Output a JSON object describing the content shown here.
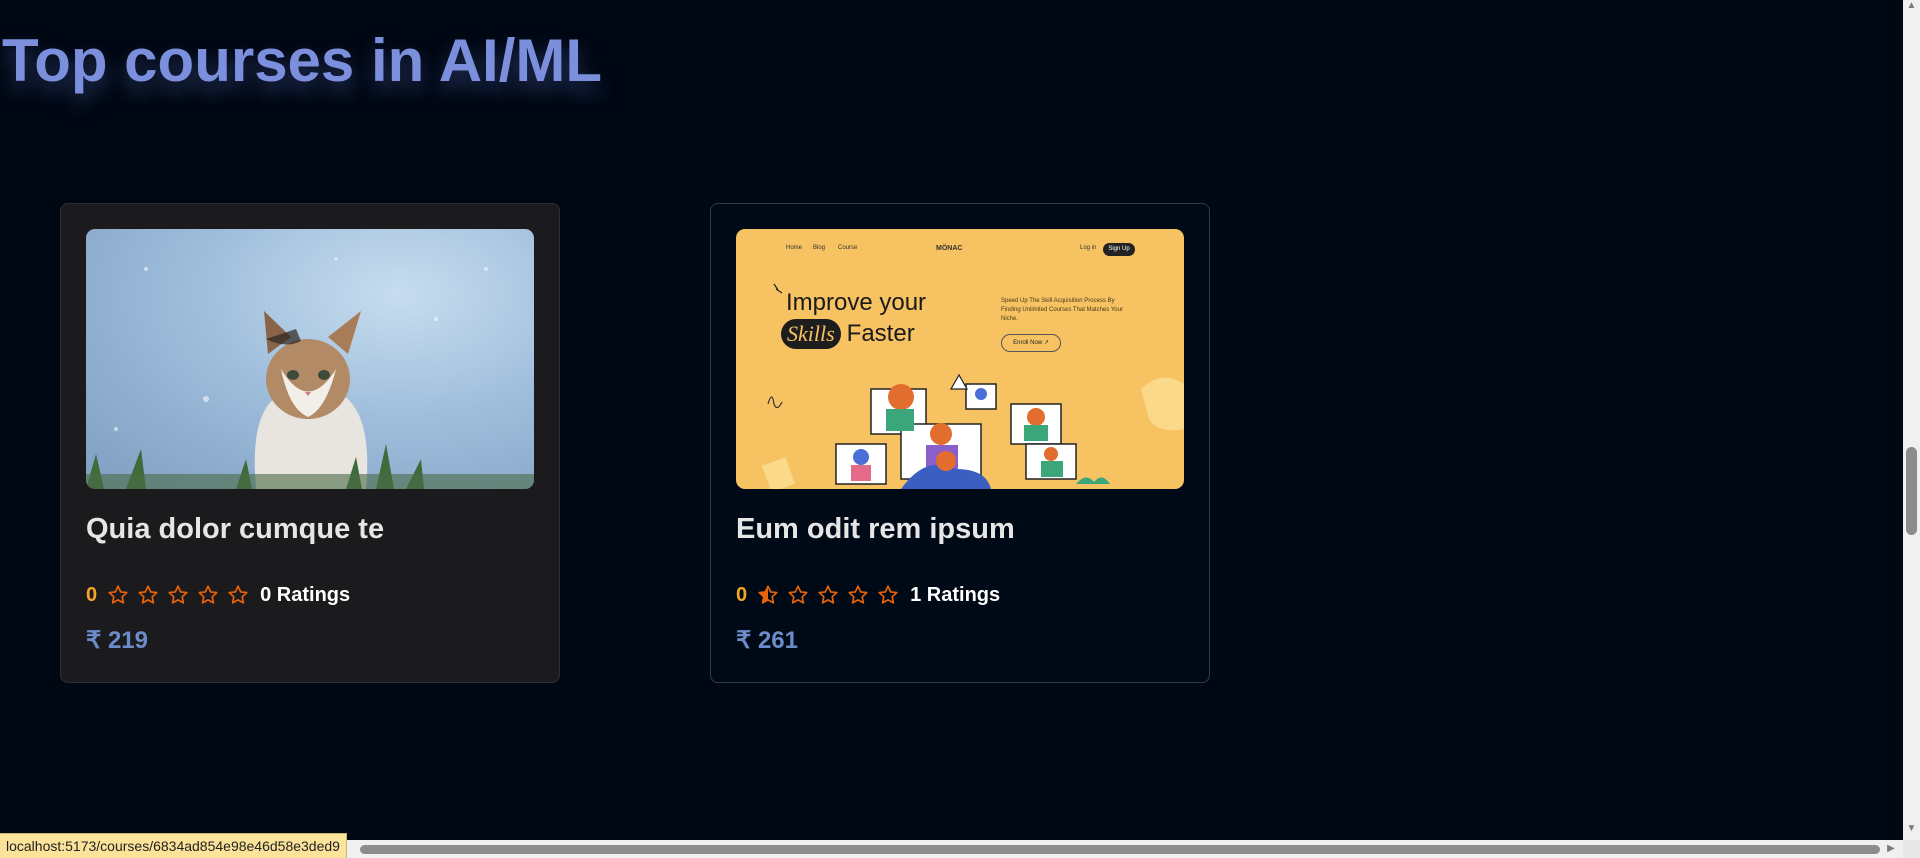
{
  "section": {
    "title": "Top courses in AI/ML"
  },
  "courses": [
    {
      "title": "Quia dolor cumque te",
      "rating_value": "0",
      "stars_filled": 0,
      "ratings_label": "0 Ratings",
      "price": "₹ 219",
      "image_icon": "cat-photo"
    },
    {
      "title": "Eum odit rem ipsum",
      "rating_value": "0",
      "stars_filled": 0.5,
      "ratings_label": "1 Ratings",
      "price": "₹ 261",
      "image_icon": "course-illustration",
      "image_text": {
        "nav_home": "Home",
        "nav_blog": "Blog",
        "nav_course": "Course",
        "brand": "MÖNAC",
        "login": "Log in",
        "signup": "Sign Up",
        "headline_1": "Improve your",
        "headline_skills": "Skills",
        "headline_2": "Faster",
        "subtext": "Speed Up The Skill Acquisition Process By Finding Unlimited Courses That Matches Your Niche.",
        "enroll": "Enroll Now ↗"
      }
    }
  ],
  "status_bar": {
    "url": "localhost:5173/courses/6834ad854e98e46d58e3ded9"
  },
  "colors": {
    "background": "#000814",
    "title": "#7b8fdc",
    "star": "#e8630a",
    "rating_value": "#f5a623",
    "price": "#6b8cc9"
  }
}
